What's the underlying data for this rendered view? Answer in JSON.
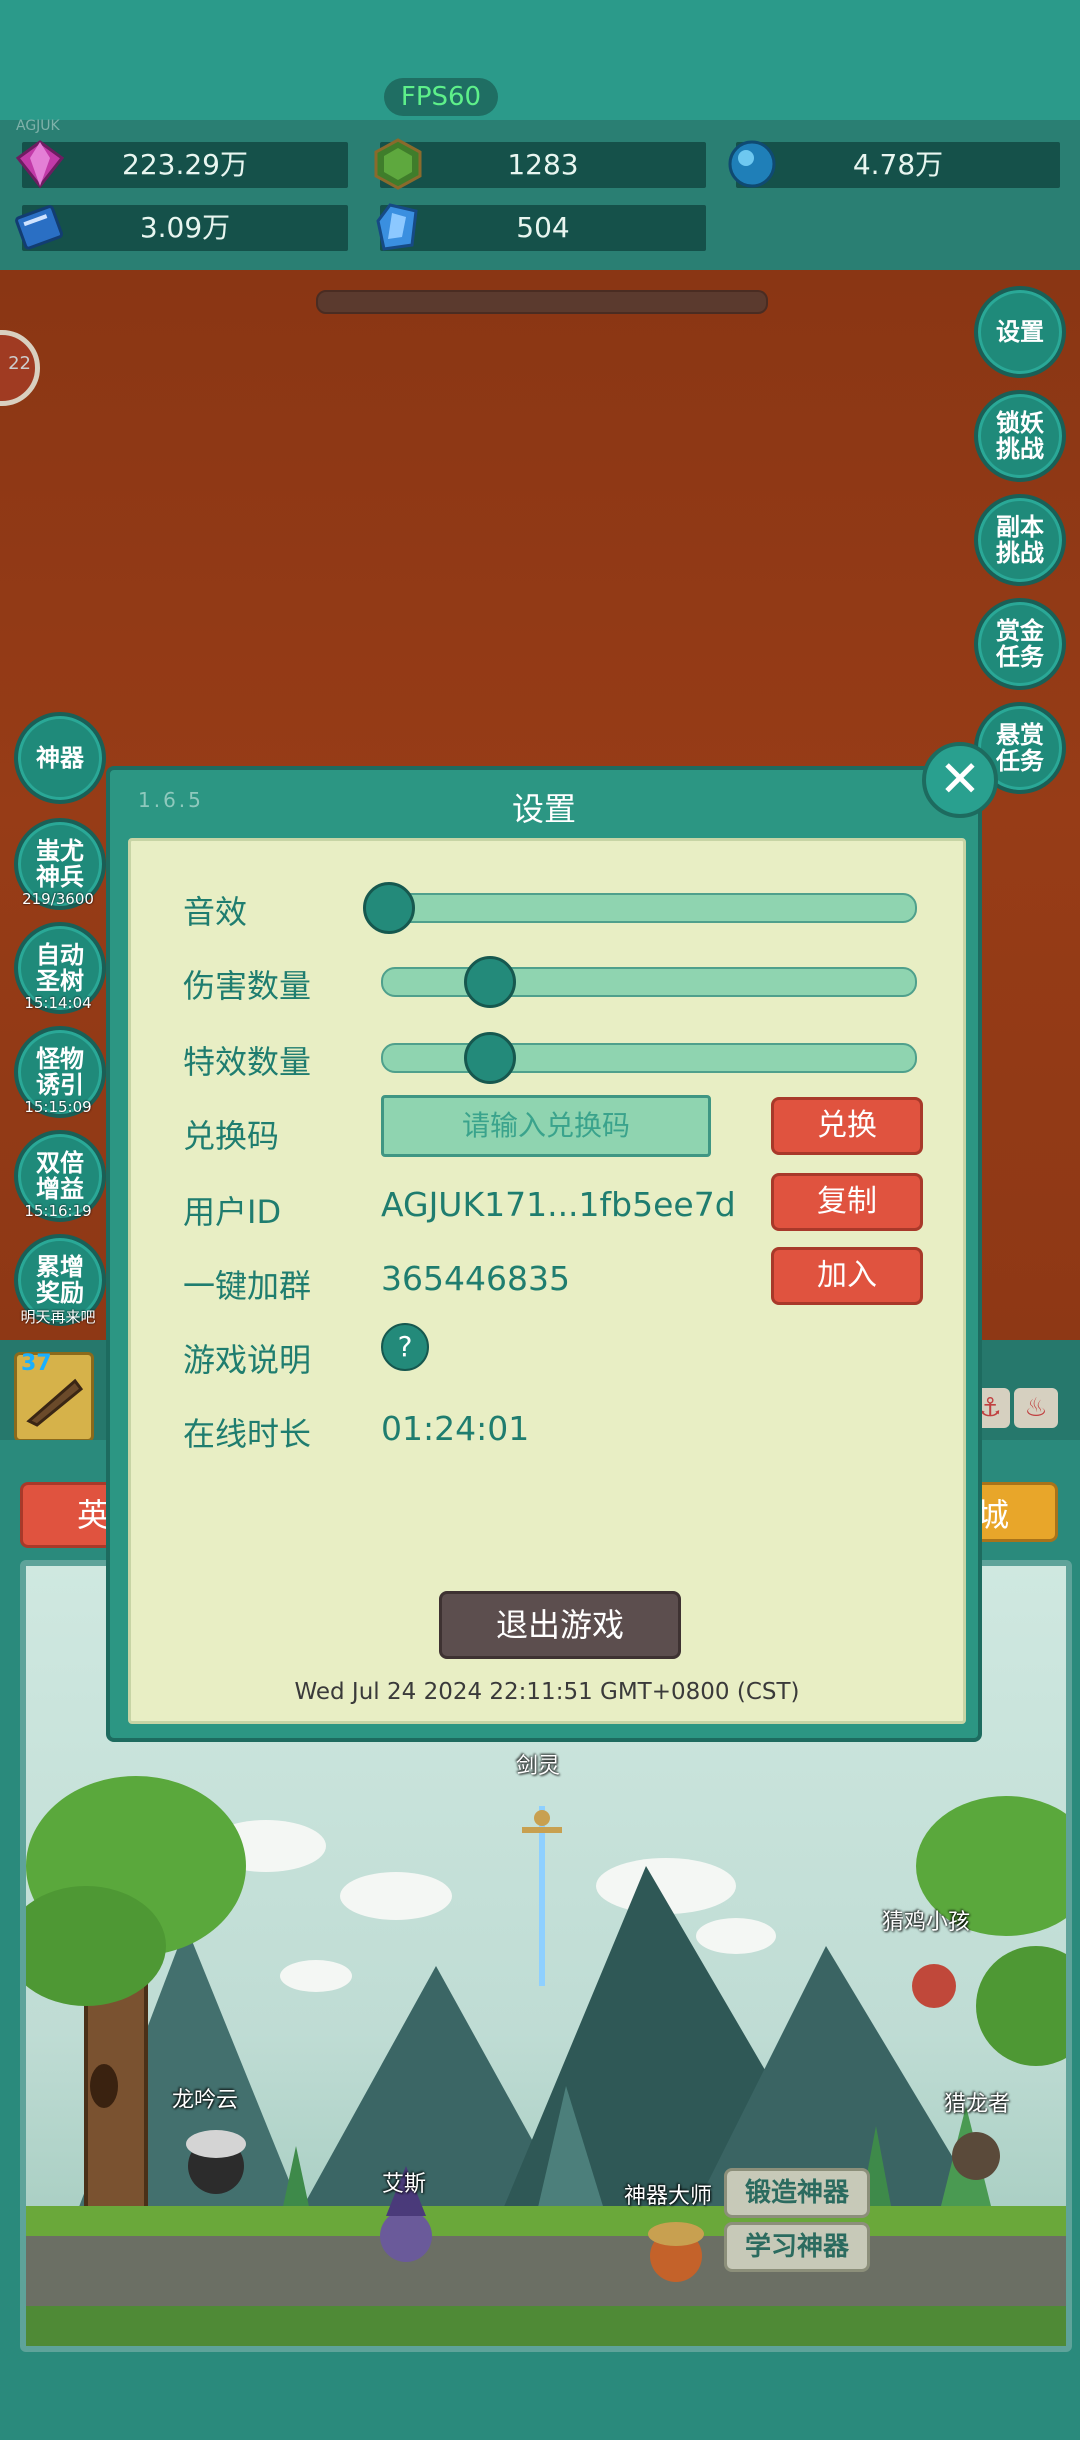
{
  "status": {
    "fps": "FPS60",
    "account_tag": "AGJUK"
  },
  "resources": [
    {
      "icon": "purple-gem-icon",
      "value": "223.29万"
    },
    {
      "icon": "green-gem-icon",
      "value": "1283"
    },
    {
      "icon": "blue-orb-icon",
      "value": "4.78万"
    },
    {
      "icon": "book-icon",
      "value": "3.09万"
    },
    {
      "icon": "blue-crystal-icon",
      "value": "504"
    }
  ],
  "avatar": {
    "level": "22"
  },
  "right_menu": [
    "设置",
    "锁妖挑战",
    "副本挑战",
    "赏金任务",
    "悬赏任务"
  ],
  "left_menu": [
    {
      "label": "神器",
      "sub": ""
    },
    {
      "label": "蚩尤神兵",
      "sub": "219/3600"
    },
    {
      "label": "自动圣树",
      "sub": "15:14:04"
    },
    {
      "label": "怪物诱引",
      "sub": "15:15:09"
    },
    {
      "label": "双倍增益",
      "sub": "15:16:19"
    },
    {
      "label": "累增奖励",
      "sub": "明天再来吧"
    }
  ],
  "bottom": {
    "slot_level": "37",
    "tab_left": "英",
    "tab_right": "城"
  },
  "dialog": {
    "version": "1.6.5",
    "title": "设置",
    "sound_label": "音效",
    "sound_level": 0.0,
    "damage_label": "伤害数量",
    "damage_level": 0.2,
    "effects_label": "特效数量",
    "effects_level": 0.2,
    "code_label": "兑换码",
    "code_placeholder": "请输入兑换码",
    "redeem_button": "兑换",
    "userid_label": "用户ID",
    "userid_value": "AGJUK171...1fb5ee7d",
    "copy_button": "复制",
    "group_label": "一键加群",
    "group_value": "365446835",
    "join_button": "加入",
    "guide_label": "游戏说明",
    "help_symbol": "?",
    "online_label": "在线时长",
    "online_value": "01:24:01",
    "exit_button": "退出游戏",
    "datetime": "Wed Jul 24 2024 22:11:51 GMT+0800 (CST)",
    "close_icon": "close-icon"
  },
  "scene": {
    "sword_name": "剑灵",
    "npcs": [
      "猜鸡小孩",
      "龙吟云",
      "猎龙者",
      "艾斯",
      "神器大师"
    ],
    "forge_button": "锻造神器",
    "learn_button": "学习神器"
  },
  "colors": {
    "teal": "#2c9683",
    "panel": "#e8eec4",
    "red_button": "#e0533f",
    "brown_bg": "#8e3815"
  }
}
